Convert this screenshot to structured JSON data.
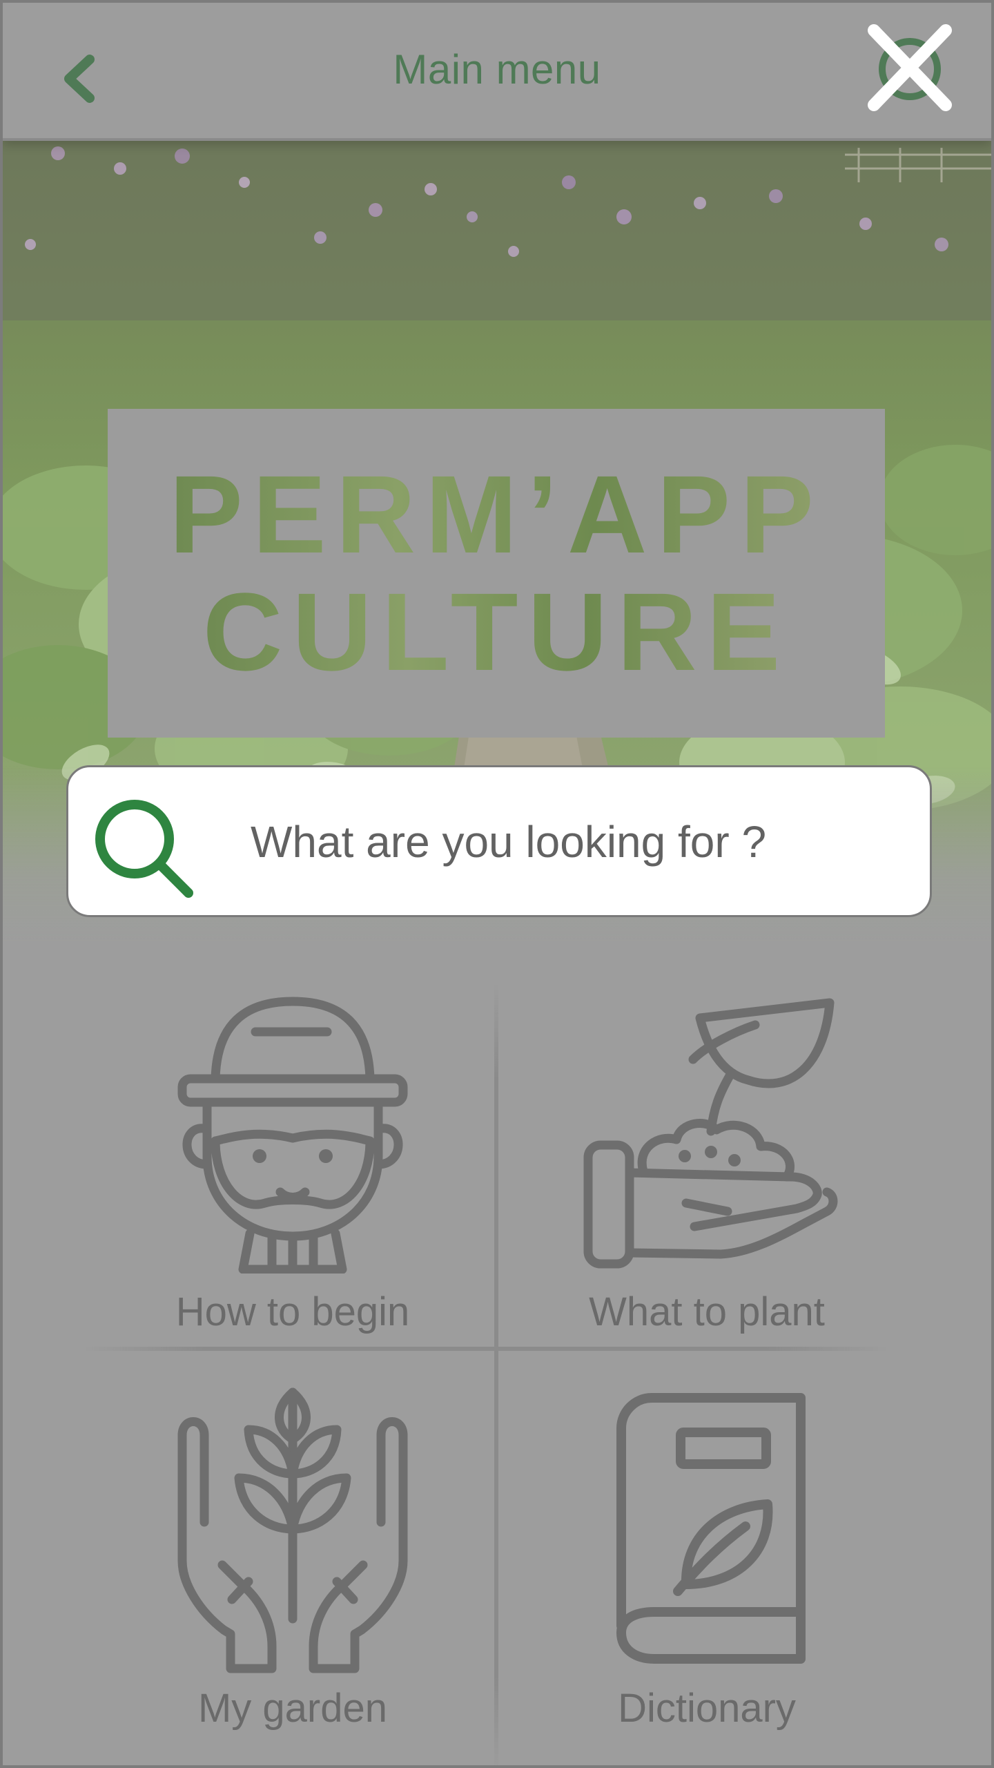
{
  "header": {
    "title": "Main menu",
    "back_icon": "chevron-left-icon",
    "close_icon": "close-icon",
    "accent_color": "#4f7a56"
  },
  "hero": {
    "logo_line1": "PERM’APP",
    "logo_line2": "CULTURE",
    "background": "garden-path-photo"
  },
  "search": {
    "placeholder": "What are you looking for ?",
    "value": "",
    "icon": "search-icon",
    "icon_color": "#2e8540"
  },
  "menu": {
    "items": [
      {
        "label": "How to begin",
        "icon": "gardener-icon"
      },
      {
        "label": "What to plant",
        "icon": "hand-sprout-icon"
      },
      {
        "label": "My garden",
        "icon": "hands-plant-icon"
      },
      {
        "label": "Dictionary",
        "icon": "book-leaf-icon"
      }
    ]
  }
}
